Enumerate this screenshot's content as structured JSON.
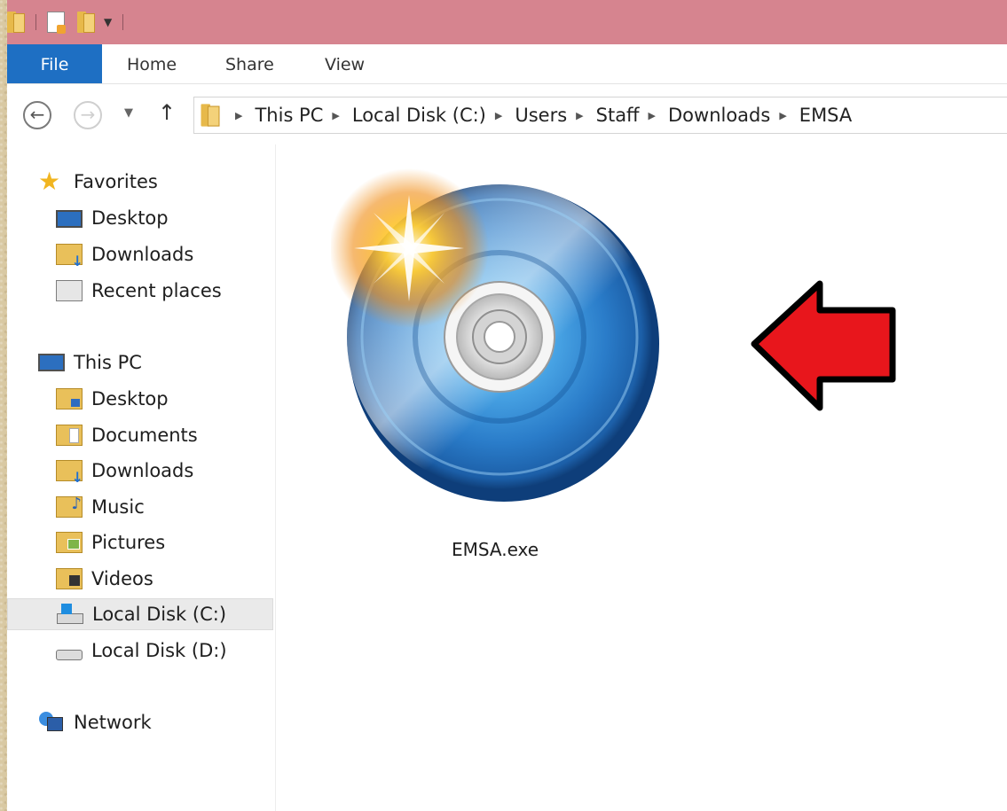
{
  "ribbon": {
    "tabs": [
      "File",
      "Home",
      "Share",
      "View"
    ]
  },
  "address": {
    "breadcrumbs": [
      "This PC",
      "Local Disk (C:)",
      "Users",
      "Staff",
      "Downloads",
      "EMSA"
    ]
  },
  "sidebar": {
    "favorites": {
      "label": "Favorites",
      "items": [
        "Desktop",
        "Downloads",
        "Recent places"
      ]
    },
    "this_pc": {
      "label": "This PC",
      "items": [
        "Desktop",
        "Documents",
        "Downloads",
        "Music",
        "Pictures",
        "Videos",
        "Local Disk (C:)",
        "Local Disk (D:)"
      ],
      "selected": "Local Disk (C:)"
    },
    "network": {
      "label": "Network"
    }
  },
  "content": {
    "files": [
      {
        "name": "EMSA.exe",
        "icon": "disc-setup-icon"
      }
    ],
    "annotation": {
      "icon": "red-arrow-left",
      "color": "#e8161c"
    }
  },
  "colors": {
    "titlebar": "#d6848f",
    "file_tab": "#1e6fc3",
    "arrow": "#e8161c"
  }
}
